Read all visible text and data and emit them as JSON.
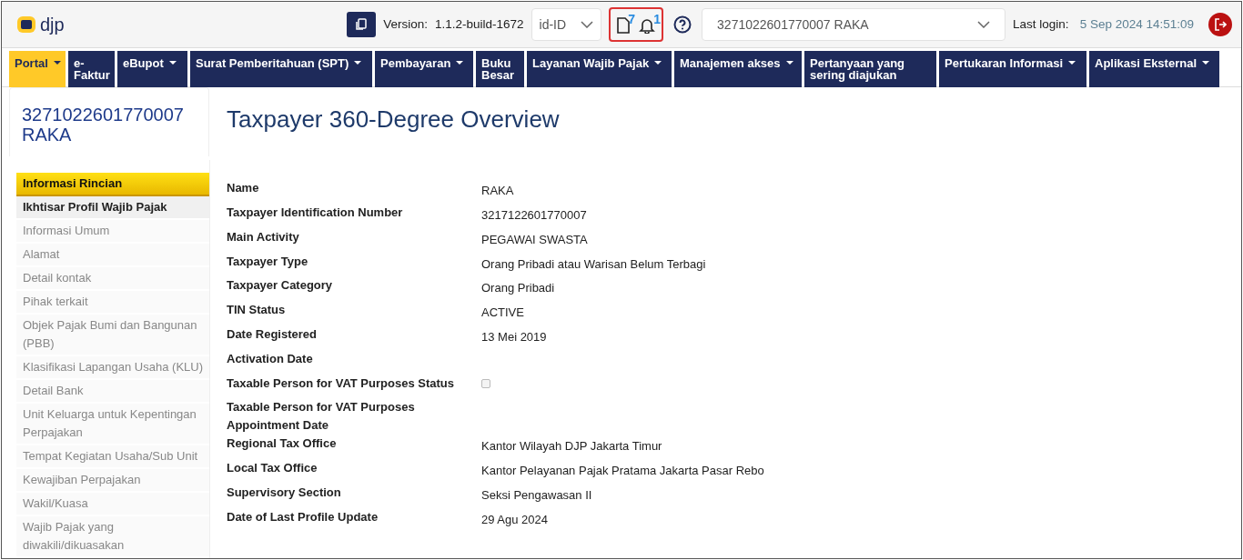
{
  "header": {
    "logo_text": "djp",
    "version_label": "Version:",
    "version": "1.1.2-build-1672",
    "language": "id-ID",
    "documents_count": "7",
    "notifications_count": "1",
    "taxpayer_select": "3271022601770007 RAKA",
    "last_login_label": "Last login:",
    "last_login": "5 Sep 2024 14:51:09"
  },
  "menu": [
    {
      "label": "Portal",
      "dropdown": true,
      "selected": true
    },
    {
      "label": "e-Faktur",
      "dropdown": false,
      "selected": false
    },
    {
      "label": "eBupot",
      "dropdown": true,
      "selected": false
    },
    {
      "label": "Surat Pemberitahuan (SPT)",
      "dropdown": true,
      "selected": false
    },
    {
      "label": "Pembayaran",
      "dropdown": true,
      "selected": false
    },
    {
      "label": "Buku Besar",
      "dropdown": false,
      "selected": false
    },
    {
      "label": "Layanan Wajib Pajak",
      "dropdown": true,
      "selected": false
    },
    {
      "label": "Manajemen akses",
      "dropdown": true,
      "selected": false
    },
    {
      "label": "Pertanyaan yang sering diajukan",
      "dropdown": false,
      "selected": false
    },
    {
      "label": "Pertukaran Informasi",
      "dropdown": true,
      "selected": false
    },
    {
      "label": "Aplikasi Eksternal",
      "dropdown": true,
      "selected": false
    }
  ],
  "sidebar": {
    "title": "3271022601770007 RAKA",
    "section": "Informasi Rincian",
    "items": [
      {
        "label": "Ikhtisar Profil Wajib Pajak",
        "selected": true
      },
      {
        "label": "Informasi Umum",
        "selected": false
      },
      {
        "label": "Alamat",
        "selected": false
      },
      {
        "label": "Detail kontak",
        "selected": false
      },
      {
        "label": "Pihak terkait",
        "selected": false
      },
      {
        "label": "Objek Pajak Bumi dan Bangunan (PBB)",
        "selected": false
      },
      {
        "label": "Klasifikasi Lapangan Usaha (KLU)",
        "selected": false
      },
      {
        "label": "Detail Bank",
        "selected": false
      },
      {
        "label": "Unit Keluarga untuk Kepentingan Perpajakan",
        "selected": false
      },
      {
        "label": "Tempat Kegiatan Usaha/Sub Unit",
        "selected": false
      },
      {
        "label": "Kewajiban Perpajakan",
        "selected": false
      },
      {
        "label": "Wakil/Kuasa",
        "selected": false
      },
      {
        "label": "Wajib Pajak yang diwakili/dikuasakan",
        "selected": false
      }
    ]
  },
  "page_title": "Taxpayer 360-Degree Overview",
  "fields": [
    {
      "label": "Name",
      "kind": "text",
      "value": "RAKA"
    },
    {
      "label": "Taxpayer Identification Number",
      "kind": "text",
      "value": "3217122601770007"
    },
    {
      "label": "Main Activity",
      "kind": "text",
      "value": "PEGAWAI SWASTA"
    },
    {
      "label": "Taxpayer Type",
      "kind": "text",
      "value": "Orang Pribadi atau Warisan Belum Terbagi"
    },
    {
      "label": "Taxpayer Category",
      "kind": "text",
      "value": "Orang Pribadi"
    },
    {
      "label": "TIN Status",
      "kind": "text",
      "value": "ACTIVE"
    },
    {
      "label": "Date Registered",
      "kind": "text",
      "value": "13 Mei 2019"
    },
    {
      "label": "Activation Date",
      "kind": "empty"
    },
    {
      "label": "Taxable Person for VAT Purposes Status",
      "kind": "checkbox",
      "checked": false
    },
    {
      "label": "Taxable Person for VAT Purposes Appointment Date",
      "kind": "empty"
    },
    {
      "label": "Regional Tax Office",
      "kind": "text",
      "value": "Kantor Wilayah DJP Jakarta Timur"
    },
    {
      "label": "Local Tax Office",
      "kind": "text",
      "value": "Kantor Pelayanan Pajak Pratama Jakarta Pasar Rebo"
    },
    {
      "label": "Supervisory Section",
      "kind": "text",
      "value": "Seksi Pengawasan II"
    },
    {
      "label": "Date of Last Profile Update",
      "kind": "text",
      "value": "29 Agu 2024"
    }
  ]
}
